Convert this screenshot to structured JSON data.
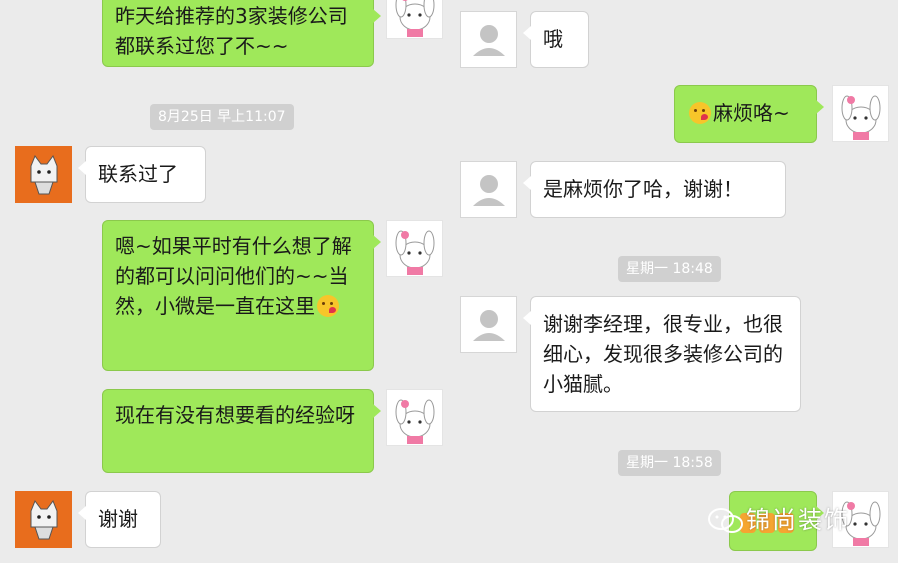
{
  "left": {
    "messages": [
      {
        "text": "昨天给推荐的3家装修公司都联系过您了不~~"
      },
      {
        "text": "联系过了"
      },
      {
        "text_before": "嗯~如果平时有什么想了解的都可以问问他们的~~当然，小微是一直在这里",
        "emoji": "kiss-face"
      },
      {
        "text": "现在有没有想要看的经验呀"
      },
      {
        "text": "谢谢"
      }
    ],
    "timestamps": [
      "8月25日 早上11:07"
    ]
  },
  "right": {
    "messages": [
      {
        "text": "哦"
      },
      {
        "emoji": "kiss-face",
        "text": "麻烦咯~"
      },
      {
        "text": "是麻烦你了哈，谢谢！"
      },
      {
        "text": "谢谢李经理，很专业，也很细心，发现很多装修公司的小猫腻。"
      }
    ],
    "timestamps": [
      "星期一 18:48",
      "星期一 18:58"
    ]
  },
  "watermark": {
    "text": "锦尚装饰",
    "icon": "wechat-icon"
  },
  "colors": {
    "background": "#ebebeb",
    "sent_bubble": "#9fe85a",
    "received_bubble": "#ffffff",
    "cat_avatar": "#e86d1d",
    "timestamp_bg": "#d0d0d0"
  }
}
